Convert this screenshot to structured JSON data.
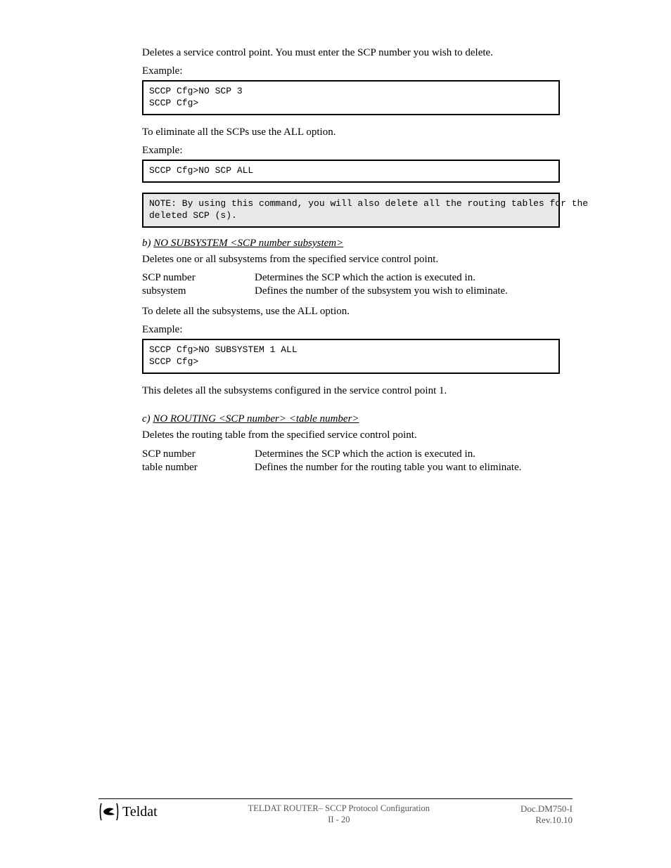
{
  "intro_para": "Deletes a service control point. You must enter the SCP number you wish to delete.",
  "example1_label": "Example:",
  "code1": "SCCP Cfg>NO SCP 3\nSCCP Cfg>",
  "all_label": "To eliminate all the SCPs use the ALL option.",
  "example2_label": "Example:",
  "code2": "SCCP Cfg>NO SCP ALL",
  "note_text": "NOTE: By using this command, you will also delete all the routing tables for the\ndeleted SCP (s).",
  "section_b": {
    "letter": "b)",
    "title": " NO SUBSYSTEM <SCP number subsystem>",
    "desc": "Deletes one or all subsystems from the specified service control point.",
    "rows": [
      {
        "term": "SCP number",
        "def": "Determines the SCP which the action is executed in."
      },
      {
        "term": "subsystem",
        "def": "Defines the number of the subsystem you wish to eliminate."
      }
    ],
    "all_note": "To delete all the subsystems, use the ALL option.",
    "example_label": "Example:",
    "code": "SCCP Cfg>NO SUBSYSTEM 1 ALL\nSCCP Cfg>",
    "final_note": "This deletes all the subsystems configured in the service control point 1."
  },
  "section_c": {
    "letter": "c)",
    "title": " NO ROUTING <SCP number> <table number>",
    "desc": "Deletes the routing table from the specified service control point.",
    "rows": [
      {
        "term": "SCP number",
        "def": "Determines the SCP which the action is executed in."
      },
      {
        "term": "table number",
        "def": "Defines the number for the routing table you want to eliminate."
      }
    ]
  },
  "footer": {
    "brand": "Teldat",
    "center_line1": "TELDAT ROUTER– SCCP Protocol Configuration",
    "center_line2": "II - 20",
    "right": "Doc.DM750-I\nRev.10.10"
  }
}
